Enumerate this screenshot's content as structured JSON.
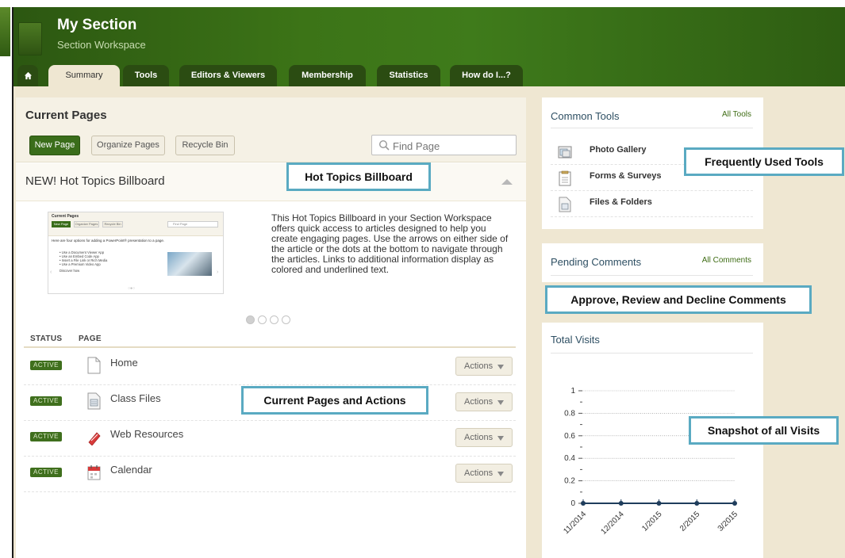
{
  "header": {
    "title": "My Section",
    "subtitle": "Section Workspace"
  },
  "tabs": [
    {
      "label": "Summary",
      "active": true
    },
    {
      "label": "Tools"
    },
    {
      "label": "Editors & Viewers"
    },
    {
      "label": "Membership"
    },
    {
      "label": "Statistics"
    },
    {
      "label": "How do I...?"
    }
  ],
  "current_pages": {
    "title": "Current Pages",
    "new_page": "New Page",
    "organize_pages": "Organize Pages",
    "recycle_bin": "Recycle Bin",
    "find_placeholder": "Find Page"
  },
  "billboard": {
    "title": "NEW! Hot Topics Billboard",
    "description": "This Hot Topics Billboard in your Section Workspace offers quick access to articles designed  to help you create engaging pages. Use the arrows on either side of the article or the dots at the bottom to navigate through the articles. Links to additional information display as colored and underlined text.",
    "thumbnail": {
      "title": "Current Pages",
      "new_page": "New Page",
      "organize": "Organize Pages",
      "recycle": "Recycle Bin",
      "find": "Find Page",
      "intro": "Here are four options for adding a PowerPoint® presentation to a page.",
      "bullets": [
        "• Use a Document Viewer App",
        "• Use an Embed Code App",
        "• Insert a File Link or Rich Media",
        "• Use a Premium Video App"
      ],
      "discover": "Discover how"
    },
    "dots_total": 4,
    "active_dot": 1
  },
  "table": {
    "status_header": "STATUS",
    "page_header": "PAGE",
    "rows": [
      {
        "status": "ACTIVE",
        "name": "Home",
        "icon": "page-icon",
        "action": "Actions"
      },
      {
        "status": "ACTIVE",
        "name": "Class Files",
        "icon": "files-icon",
        "action": "Actions"
      },
      {
        "status": "ACTIVE",
        "name": "Web Resources",
        "icon": "link-icon",
        "action": "Actions"
      },
      {
        "status": "ACTIVE",
        "name": "Calendar",
        "icon": "calendar-icon",
        "action": "Actions"
      }
    ]
  },
  "common_tools": {
    "title": "Common Tools",
    "all_link": "All Tools",
    "items": [
      {
        "label": "Photo Gallery",
        "icon": "photo-gallery-icon"
      },
      {
        "label": "Forms & Surveys",
        "icon": "forms-icon"
      },
      {
        "label": "Files & Folders",
        "icon": "files-folders-icon"
      }
    ]
  },
  "pending_comments": {
    "title": "Pending Comments",
    "all_link": "All Comments"
  },
  "visits": {
    "title": "Total Visits"
  },
  "callouts": {
    "billboard": "Hot Topics Billboard",
    "tools": "Frequently Used Tools",
    "comments": "Approve, Review and Decline Comments",
    "pages": "Current Pages and Actions",
    "visits": "Snapshot of all Visits"
  },
  "colors": {
    "header_green": "#3c7417",
    "button_green": "#3a6d1a",
    "badge_green": "#3f6f1d",
    "callout_border": "#5aaac2",
    "chart_line": "#1f3d5c"
  },
  "chart_data": {
    "type": "line",
    "title": "Total Visits",
    "categories": [
      "11/2014",
      "12/2014",
      "1/2015",
      "2/2015",
      "3/2015"
    ],
    "values": [
      0,
      0,
      0,
      0,
      0
    ],
    "ylim": [
      0,
      1
    ],
    "yticks": [
      "0",
      "0.2",
      "0.4",
      "0.6",
      "0.8",
      "1"
    ],
    "grid": true
  }
}
